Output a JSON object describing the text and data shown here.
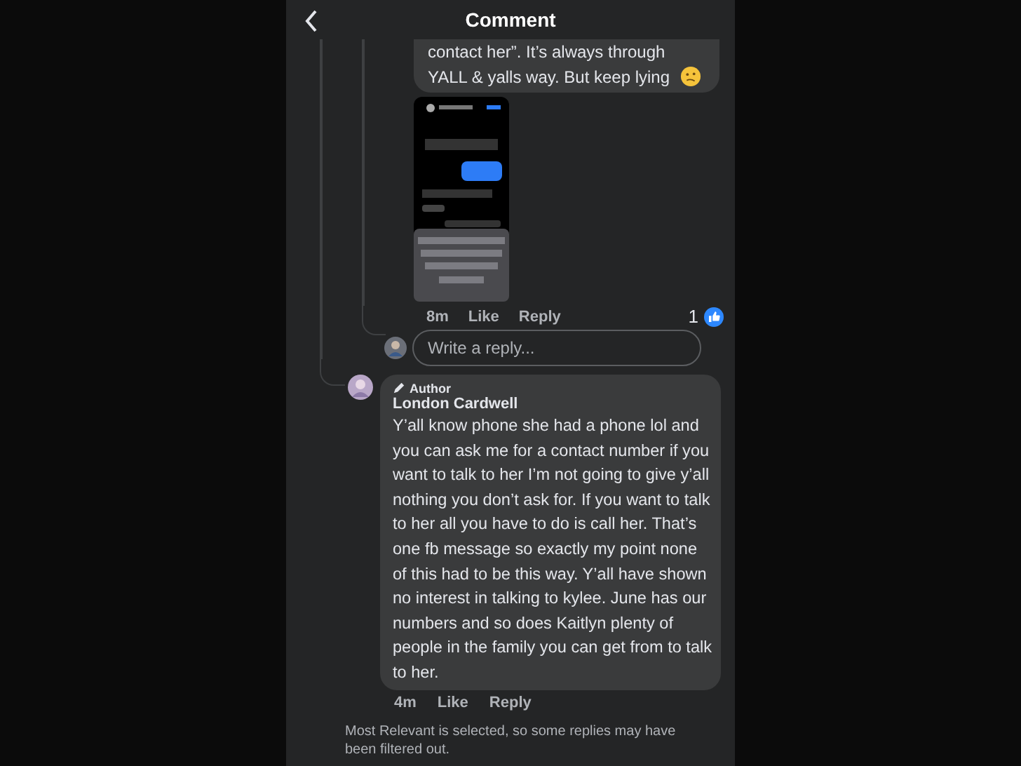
{
  "header": {
    "title": "Comment"
  },
  "reply": {
    "text": "contact her”. It’s always through YALL & yalls way. But keep lying",
    "attachment": {
      "kind": "screenshot"
    },
    "time": "8m",
    "actions": [
      "Like",
      "Reply"
    ],
    "reaction_count": "1"
  },
  "reply_box": {
    "placeholder": "Write a reply..."
  },
  "comment": {
    "badge": "Author",
    "author": "London Cardwell",
    "text": "Y’all know phone she had a phone lol and you can ask me for a contact number if you want to talk to her I’m not going to give y’all nothing you don’t ask for. If you want to talk to her all you have to do is call her. That’s one fb message so exactly my point none of this had to be this way. Y’all have shown no interest in talking to kylee. June has our numbers and so does Kaitlyn plenty of people in the family you can get from to talk to her.",
    "time": "4m",
    "actions": [
      "Like",
      "Reply"
    ]
  },
  "footer_note": "Most Relevant is selected, so some replies may have been filtered out."
}
